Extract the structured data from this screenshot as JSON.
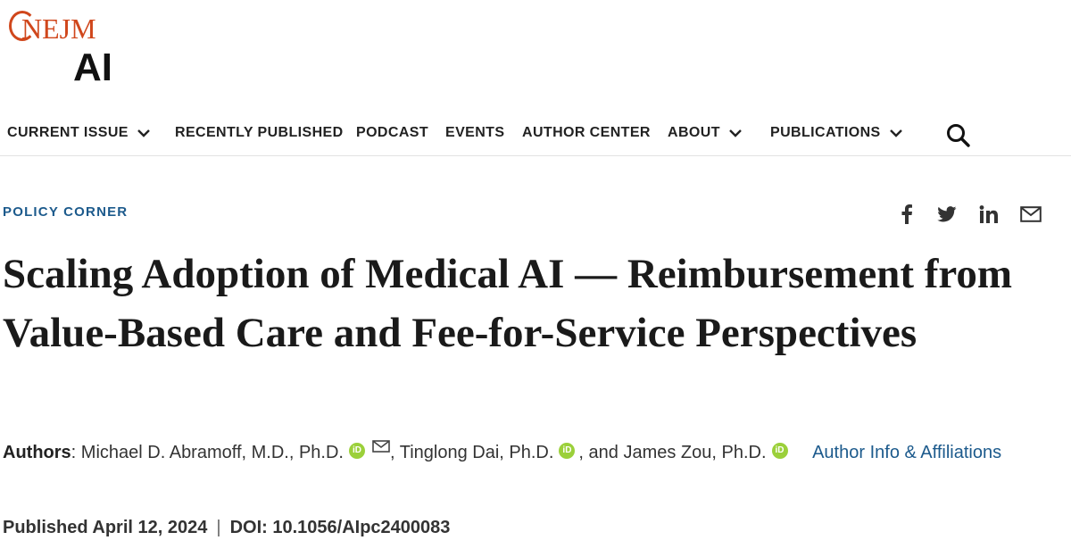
{
  "logo": {
    "brand": "NEJM",
    "sub": "AI"
  },
  "nav": {
    "items": [
      {
        "label": "CURRENT ISSUE",
        "dropdown": true
      },
      {
        "label": "RECENTLY PUBLISHED",
        "dropdown": false
      },
      {
        "label": "PODCAST",
        "dropdown": false
      },
      {
        "label": "EVENTS",
        "dropdown": false
      },
      {
        "label": "AUTHOR CENTER",
        "dropdown": false
      },
      {
        "label": "ABOUT",
        "dropdown": true
      },
      {
        "label": "PUBLICATIONS",
        "dropdown": true
      }
    ],
    "search_icon": "search-icon"
  },
  "article": {
    "category": "POLICY CORNER",
    "title": "Scaling Adoption of Medical AI — Reimbursement from Value-Based Care and Fee-for-Service Perspectives",
    "authors_label": "Authors",
    "authors": [
      {
        "name": "Michael D. Abramoff, M.D., Ph.D.",
        "orcid": true,
        "email": true
      },
      {
        "name": "Tinglong Dai, Ph.D.",
        "orcid": true,
        "email": false
      },
      {
        "name": "James Zou, Ph.D.",
        "orcid": true,
        "email": false
      }
    ],
    "author_sep_1": ",",
    "author_sep_2": ", and",
    "affiliations_link": "Author Info & Affiliations",
    "published": "Published April 12, 2024",
    "pub_sep": "|",
    "doi": "DOI: 10.1056/AIpc2400083"
  },
  "share": [
    "facebook-icon",
    "twitter-icon",
    "linkedin-icon",
    "email-icon"
  ],
  "colors": {
    "brand": "#d0471c",
    "link": "#1c5a8c",
    "orcid": "#9bd03a",
    "text": "#1a1a1a"
  }
}
